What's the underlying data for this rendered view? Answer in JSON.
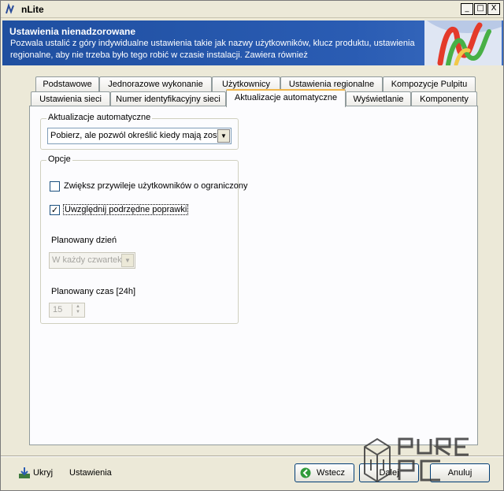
{
  "window": {
    "title": "nLite",
    "min": "_",
    "max": "□",
    "close": "X"
  },
  "header": {
    "title": "Ustawienia nienadzorowane",
    "description": "Pozwala ustalić z góry indywidualne ustawienia takie jak nazwy użytkowników, klucz produktu, ustawienia regionalne, aby nie trzeba było tego robić w czasie instalacji. Zawiera również"
  },
  "tabs": {
    "row1": [
      "Podstawowe",
      "Jednorazowe wykonanie",
      "Użytkownicy",
      "Ustawienia regionalne",
      "Kompozycje Pulpitu"
    ],
    "row2": [
      "Ustawienia sieci",
      "Numer identyfikacyjny sieci",
      "Aktualizacje automatyczne",
      "Wyświetlanie",
      "Komponenty"
    ],
    "active": "Aktualizacje automatyczne"
  },
  "auto_updates": {
    "group_label": "Aktualizacje automatyczne",
    "selected": "Pobierz, ale pozwól określić kiedy mają zosta"
  },
  "options": {
    "group_label": "Opcje",
    "checkbox1_label": "Zwiększ przywileje użytkowników o ograniczony",
    "checkbox1_checked": false,
    "checkbox2_label": "Uwzględnij podrzędne poprawki",
    "checkbox2_checked": true,
    "checkmark": "✓",
    "day_label": "Planowany dzień",
    "day_value": "W każdy czwartek",
    "time_label": "Planowany czas [24h]",
    "time_value": "15"
  },
  "bottom": {
    "hide_label": "Ukryj",
    "settings_label": "Ustawienia",
    "back_label": "Wstecz",
    "next_label": "Dalej",
    "cancel_label": "Anuluj"
  },
  "watermark": {
    "text": "PURE PC"
  }
}
